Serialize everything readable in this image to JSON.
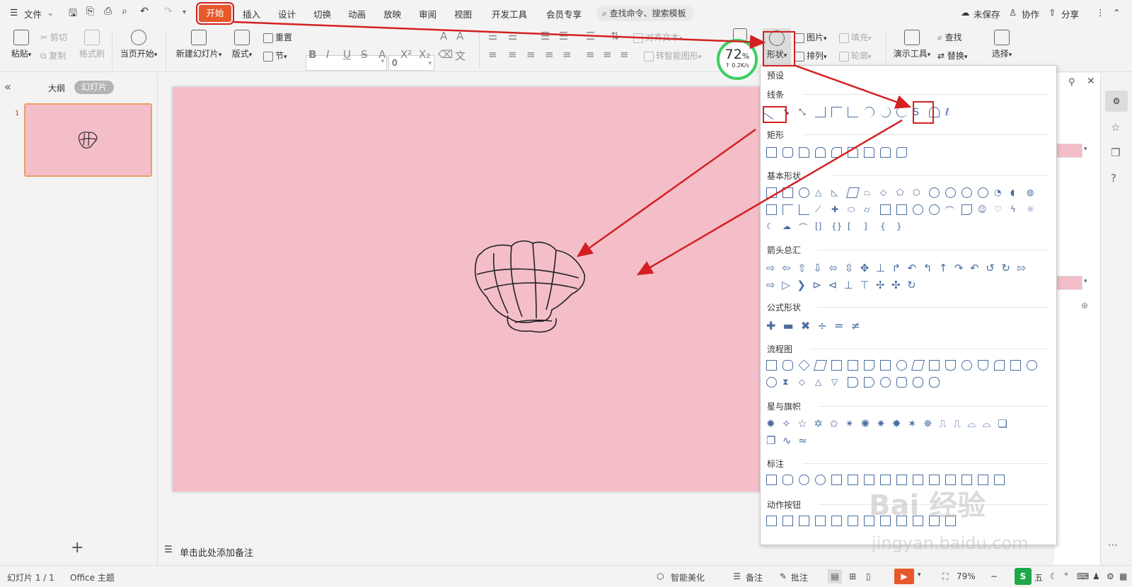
{
  "menubar": {
    "file": "文件",
    "tabs": [
      "开始",
      "插入",
      "设计",
      "切换",
      "动画",
      "放映",
      "审阅",
      "视图",
      "开发工具",
      "会员专享"
    ],
    "search": "查找命令、搜索模板",
    "unsaved": "未保存",
    "collab": "协作",
    "share": "分享"
  },
  "ribbon": {
    "paste": "粘贴",
    "cut": "剪切",
    "copy": "复制",
    "format_painter": "格式刷",
    "from_current": "当页开始",
    "new_slide": "新建幻灯片",
    "layout": "版式",
    "reset": "重置",
    "section": "节",
    "font_size": "0",
    "text_box": "文本框",
    "shape": "形状",
    "picture": "图片",
    "fill": "填充",
    "arrange": "排列",
    "outline": "轮廓",
    "smart_art": "转智能图形",
    "presenter_tools": "演示工具",
    "find": "查找",
    "replace": "替换",
    "select": "选择",
    "align_text": "对齐文本"
  },
  "badge": {
    "percent": "72",
    "unit": "%",
    "speed": "0.2K/s"
  },
  "leftpanel": {
    "outline_tab": "大纲",
    "slides_tab": "幻灯片",
    "slide_number": "1"
  },
  "notes": {
    "placeholder": "单击此处添加备注"
  },
  "shapes_menu": {
    "preset": "预设",
    "sections": [
      "线条",
      "矩形",
      "基本形状",
      "箭头总汇",
      "公式形状",
      "流程图",
      "星与旗帜",
      "标注",
      "动作按钮"
    ]
  },
  "statusbar": {
    "slide_info": "幻灯片 1 / 1",
    "theme": "Office 主题",
    "beautify": "智能美化",
    "notes": "备注",
    "comments": "批注",
    "zoom": "79%"
  },
  "watermark": {
    "logo": "Bai 经验",
    "url": "jingyan.baidu.com"
  },
  "colors": {
    "accent": "#e8582a",
    "slide_bg": "#f4bec9",
    "highlight": "#d42020",
    "progress": "#3ccf60"
  }
}
